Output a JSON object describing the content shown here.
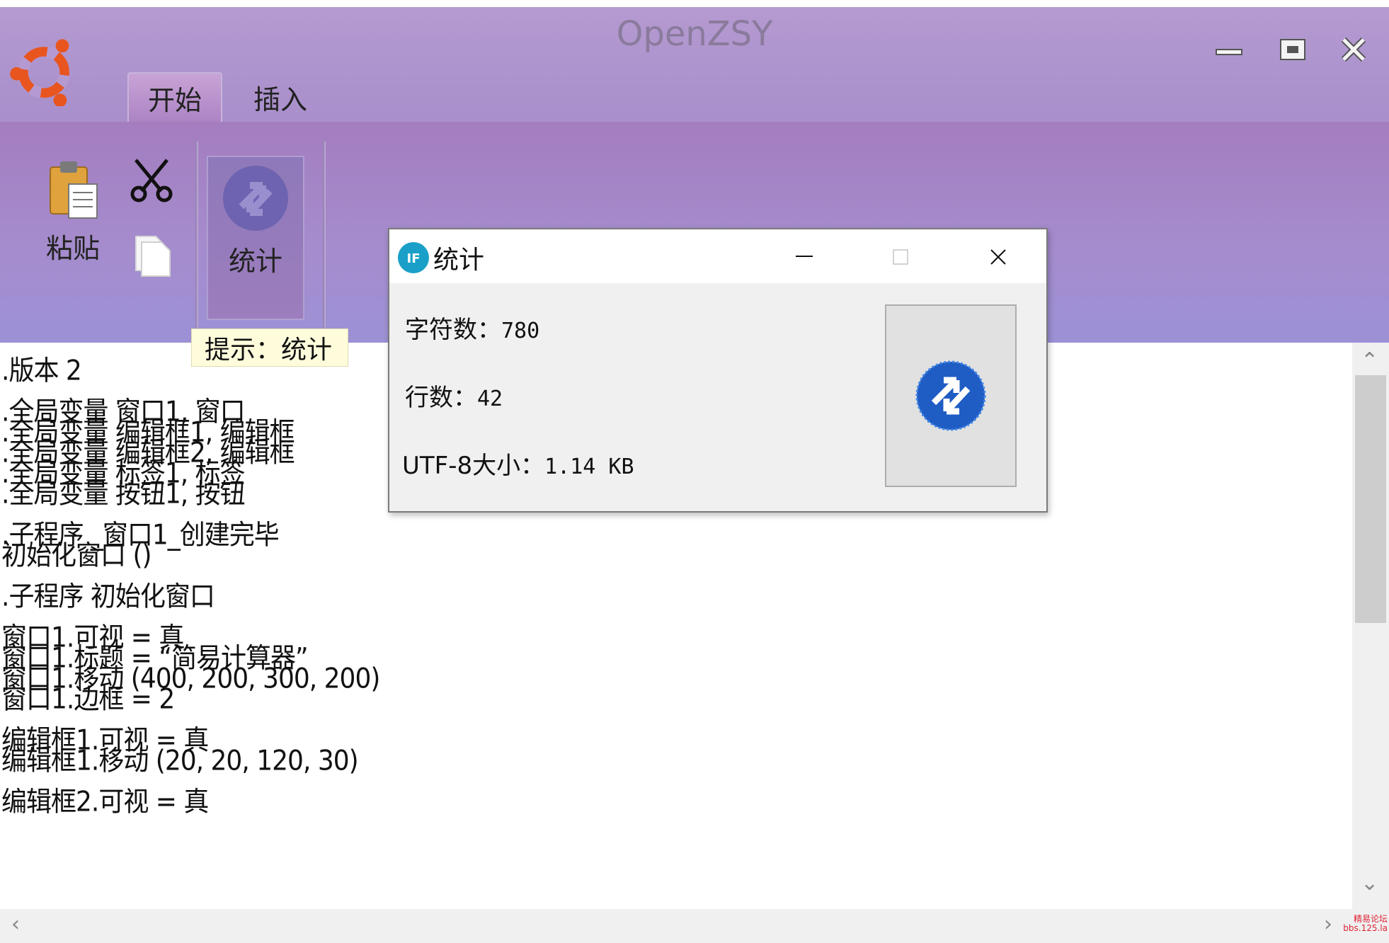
{
  "window": {
    "title": "OpenZSY",
    "controls": {
      "minimize": "minimize",
      "maximize": "maximize",
      "close": "close"
    }
  },
  "tabs": [
    {
      "label": "开始",
      "active": true
    },
    {
      "label": "插入",
      "active": false
    }
  ],
  "ribbon": {
    "paste_label": "粘贴",
    "stat_label": "统计",
    "tooltip": "提示：统计"
  },
  "editor": {
    "lines": [
      ".版本 2",
      "",
      ".全局变量 窗口1, 窗口",
      ".全局变量 编辑框1, 编辑框",
      ".全局变量 编辑框2, 编辑框",
      ".全局变量 标签1, 标签",
      ".全局变量 按钮1, 按钮",
      "",
      ".子程序 _窗口1_创建完毕",
      "初始化窗口 ()",
      "",
      ".子程序 初始化窗口",
      "",
      "窗口1.可视 = 真",
      "窗口1.标题 = “简易计算器”",
      "窗口1.移动 (400, 200, 300, 200)",
      "窗口1.边框 = 2",
      "",
      "编辑框1.可视 = 真",
      "编辑框1.移动 (20, 20, 120, 30)",
      "",
      "编辑框2.可视 = 真"
    ]
  },
  "dialog": {
    "title": "统计",
    "char_count_label": "字符数：",
    "char_count": "780",
    "line_count_label": "行数：",
    "line_count": "42",
    "utf8_label": "UTF-8大小：",
    "utf8_size": "1.14 KB"
  },
  "watermark": {
    "line1": "精易论坛",
    "line2": "bbs.125.la"
  },
  "colors": {
    "title_bar": "#b49ad0",
    "ribbon": "#a58ccd",
    "dialog_bg": "#f0f0f0",
    "tooltip_bg": "#fffcdc"
  }
}
